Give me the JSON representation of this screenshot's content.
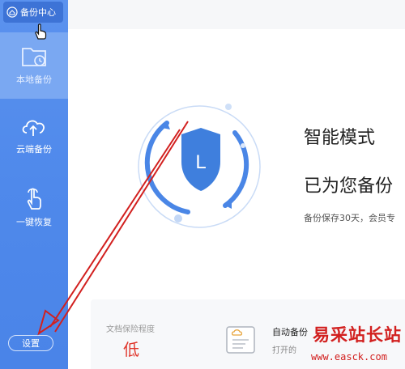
{
  "sidebar": {
    "app_title": "备份中心",
    "items": [
      {
        "label": "本地备份",
        "icon": "local-backup-folder-icon"
      },
      {
        "label": "云端备份",
        "icon": "cloud-upload-icon"
      },
      {
        "label": "一键恢复",
        "icon": "tap-hand-icon"
      }
    ],
    "settings_label": "设置"
  },
  "main": {
    "mode_title": "智能模式",
    "mode_status": "已为您备份",
    "mode_desc": "备份保存30天，会员专",
    "shield_letter": "L"
  },
  "bottom": {
    "doc_protection_label": "文档保险程度",
    "doc_protection_value": "低",
    "auto_backup_title": "自动备份",
    "auto_backup_sub": "打开的"
  },
  "watermark": {
    "site_name": "易采站长站",
    "url": "www.easck.com"
  },
  "colors": {
    "sidebar_blue": "#4f89eb",
    "active_item": "#7aa8f2",
    "shield_blue": "#3f7fdd",
    "risk_red": "#e0362c",
    "annotation_red": "#d2201f"
  }
}
